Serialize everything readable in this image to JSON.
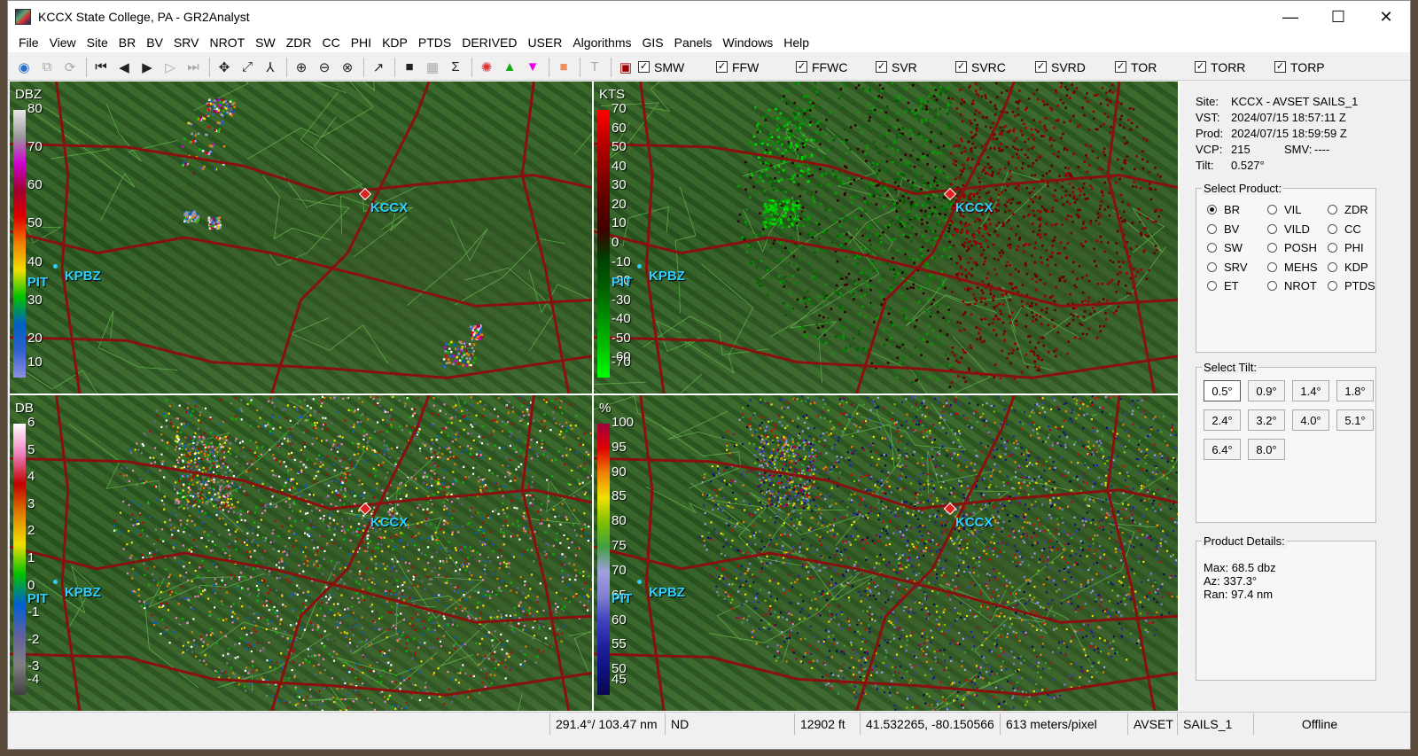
{
  "window": {
    "title": "KCCX State College, PA - GR2Analyst",
    "min": "—",
    "max": "☐",
    "close": "✕"
  },
  "menu": [
    "File",
    "View",
    "Site",
    "BR",
    "BV",
    "SRV",
    "NROT",
    "SW",
    "ZDR",
    "CC",
    "PHI",
    "KDP",
    "PTDS",
    "DERIVED",
    "USER",
    "Algorithms",
    "GIS",
    "Panels",
    "Windows",
    "Help"
  ],
  "toolbar": {
    "warnings": [
      {
        "label": "SMW",
        "checked": true
      },
      {
        "label": "FFW",
        "checked": true
      },
      {
        "label": "FFWC",
        "checked": true
      },
      {
        "label": "SVR",
        "checked": true
      },
      {
        "label": "SVRC",
        "checked": true
      },
      {
        "label": "SVRD",
        "checked": true
      },
      {
        "label": "TOR",
        "checked": true
      },
      {
        "label": "TORR",
        "checked": true
      },
      {
        "label": "TORP",
        "checked": true
      }
    ]
  },
  "panes": [
    {
      "unit": "DBZ",
      "labels": [
        "80",
        "70",
        "60",
        "50",
        "40",
        "30",
        "20",
        "10"
      ],
      "colors": [
        "#e8e8e8",
        "#9a9a9a",
        "#d000d0",
        "#a00030",
        "#e00000",
        "#f08000",
        "#f0e000",
        "#00c000",
        "#0060c0",
        "#3060d0",
        "#9090e0"
      ]
    },
    {
      "unit": "KTS",
      "labels": [
        "70",
        "60",
        "50",
        "40",
        "30",
        "20",
        "10",
        "0",
        "-10",
        "-20",
        "-30",
        "-40",
        "-50",
        "-60",
        "-70"
      ],
      "colors": [
        "#ff0000",
        "#c00000",
        "#900000",
        "#600000",
        "#400000",
        "#004000",
        "#006000",
        "#009000",
        "#00c000",
        "#00ff00"
      ]
    },
    {
      "unit": "DB",
      "labels": [
        "6",
        "5",
        "4",
        "3",
        "2",
        "1",
        "0",
        "-1",
        "-2",
        "-3",
        "-4"
      ],
      "colors": [
        "#ffffff",
        "#f080c0",
        "#c00000",
        "#e08000",
        "#f0e000",
        "#00c000",
        "#0060d0",
        "#6060a0",
        "#808080",
        "#404040"
      ]
    },
    {
      "unit": "%",
      "labels": [
        "100",
        "95",
        "90",
        "85",
        "80",
        "75",
        "70",
        "65",
        "60",
        "55",
        "50",
        "45"
      ],
      "colors": [
        "#a00040",
        "#e00000",
        "#f08000",
        "#f0e000",
        "#80c000",
        "#40a040",
        "#a0a0e0",
        "#8080d0",
        "#4040c0",
        "#2020a0",
        "#101080",
        "#080850"
      ]
    }
  ],
  "map": {
    "radar": "KCCX",
    "site2": "KPBZ",
    "city": "PIT"
  },
  "side": {
    "site_label": "Site:",
    "site_value": "KCCX - AVSET SAILS_1",
    "vst_label": "VST:",
    "vst_value": "2024/07/15  18:57:11 Z",
    "prod_label": "Prod:",
    "prod_value": "2024/07/15  18:59:59 Z",
    "vcp_label": "VCP:",
    "vcp_value": "215",
    "smv_label": "SMV:",
    "smv_value": "----",
    "tilt_label": "Tilt:",
    "tilt_value": "0.527°",
    "select_product": "Select Product:",
    "products": [
      "BR",
      "VIL",
      "ZDR",
      "BV",
      "VILD",
      "CC",
      "SW",
      "POSH",
      "PHI",
      "SRV",
      "MEHS",
      "KDP",
      "ET",
      "NROT",
      "PTDS"
    ],
    "selected_product": "BR",
    "select_tilt": "Select Tilt:",
    "tilts": [
      "0.5°",
      "0.9°",
      "1.4°",
      "1.8°",
      "2.4°",
      "3.2°",
      "4.0°",
      "5.1°",
      "6.4°",
      "8.0°"
    ],
    "selected_tilt": "0.5°",
    "product_details": "Product Details:",
    "max": "Max:  68.5 dbz",
    "az": "Az:   337.3°",
    "ran": "Ran:  97.4 nm"
  },
  "status": {
    "az_range": "291.4°/ 103.47 nm",
    "value": "ND",
    "height": "12902 ft",
    "coords": "41.532265, -80.150566",
    "scale": "613 meters/pixel",
    "mode": "AVSET",
    "sails": "SAILS_1",
    "connection": "Offline"
  }
}
